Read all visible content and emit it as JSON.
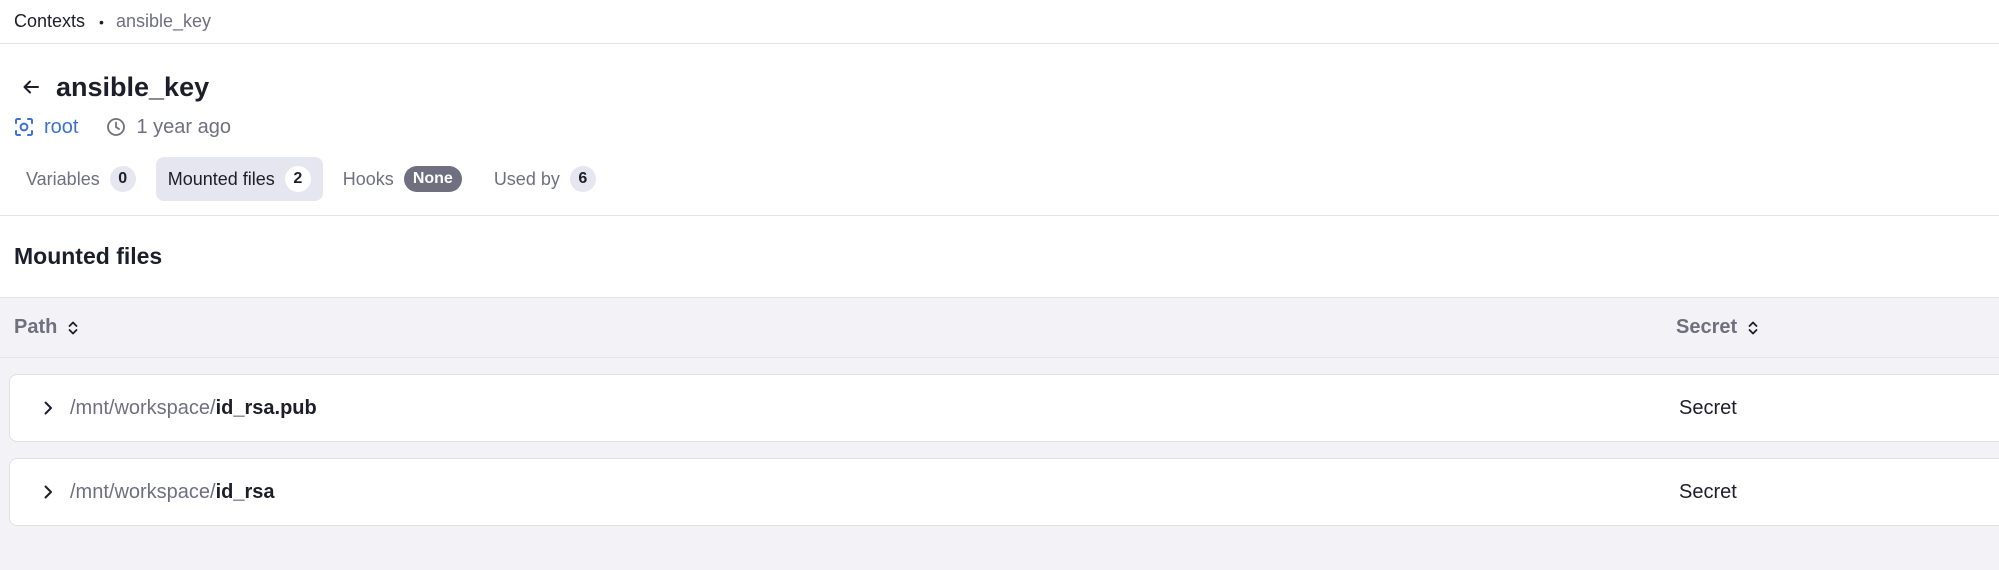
{
  "breadcrumb": {
    "parent": "Contexts",
    "separator": "•",
    "current": "ansible_key"
  },
  "header": {
    "title": "ansible_key",
    "space": "root",
    "updated": "1 year ago"
  },
  "tabs": [
    {
      "label": "Variables",
      "badge": "0",
      "active": false
    },
    {
      "label": "Mounted files",
      "badge": "2",
      "active": true
    },
    {
      "label": "Hooks",
      "badge": "None",
      "active": false
    },
    {
      "label": "Used by",
      "badge": "6",
      "active": false
    }
  ],
  "section": {
    "title": "Mounted files"
  },
  "table": {
    "columns": [
      "Path",
      "Secret"
    ],
    "rows": [
      {
        "prefix": "/mnt/workspace/",
        "file": "id_rsa.pub",
        "secret": "Secret"
      },
      {
        "prefix": "/mnt/workspace/",
        "file": "id_rsa",
        "secret": "Secret"
      }
    ]
  },
  "colors": {
    "accent": "#3a6fd8",
    "muted": "#6f6f80",
    "text": "#1e1e2a",
    "background": "#f3f3f7"
  },
  "icons": {
    "back": "arrow-left-icon",
    "space": "space-icon",
    "time": "clock-icon",
    "sort": "sort-icon",
    "expand": "chevron-right-icon"
  }
}
